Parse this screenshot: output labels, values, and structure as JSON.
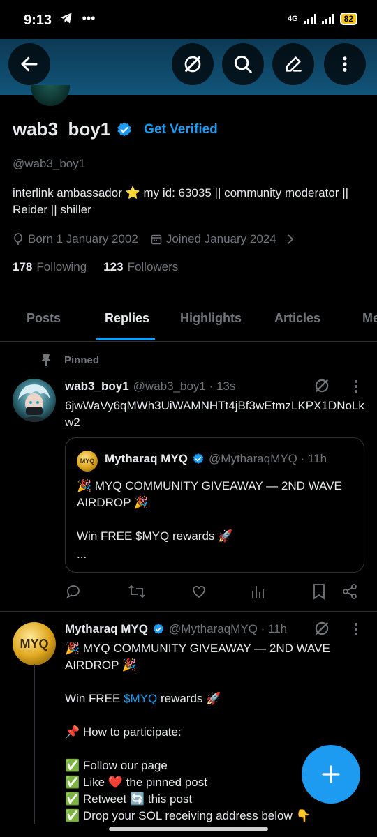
{
  "status_bar": {
    "time": "9:13",
    "network": "4G",
    "battery": "82"
  },
  "header": {
    "back": "back",
    "actions": [
      "grok",
      "search",
      "edit",
      "more"
    ]
  },
  "profile": {
    "name": "wab3_boy1",
    "get_verified": "Get Verified",
    "handle": "@wab3_boy1",
    "bio": "interlink ambassador ⭐ my id: 63035 || community moderator || Reider || shiller",
    "born": "Born 1 January 2002",
    "joined": "Joined January 2024",
    "following_count": "178",
    "following_label": "Following",
    "followers_count": "123",
    "followers_label": "Followers"
  },
  "tabs": [
    "Posts",
    "Replies",
    "Highlights",
    "Articles",
    "Me"
  ],
  "active_tab": "Replies",
  "pinned_label": "Pinned",
  "post1": {
    "name": "wab3_boy1",
    "handle_time": "@wab3_boy1 · 13s",
    "text": "6jwWaVy6qMWh3UiWAMNHTt4jBf3wEtmzLKPX1DNoLkw2",
    "quote": {
      "name": "Mytharaq MYQ",
      "handle_time": "@MytharaqMYQ · 11h",
      "line1": "🎉 MYQ COMMUNITY GIVEAWAY — 2ND WAVE AIRDROP 🎉",
      "line2": "Win FREE $MYQ rewards 🚀",
      "line3": "..."
    }
  },
  "post2": {
    "name": "Mytharaq MYQ",
    "handle_time": "@MytharaqMYQ · 11h",
    "line1": "🎉 MYQ COMMUNITY GIVEAWAY — 2ND WAVE AIRDROP 🎉",
    "win_prefix": "Win FREE ",
    "cashtag": "$MYQ",
    "win_suffix": " rewards 🚀",
    "how": "📌 How to participate:",
    "step1": "✅ Follow our page",
    "step2": "✅ Like ❤️ the pinned post",
    "step3": "✅ Retweet 🔄 this post",
    "step4": "✅ Drop your SOL receiving address below 👇"
  },
  "colors": {
    "accent": "#1d9bf0",
    "muted": "#71767b",
    "text": "#e7e9ea",
    "banner": "#11557a"
  }
}
